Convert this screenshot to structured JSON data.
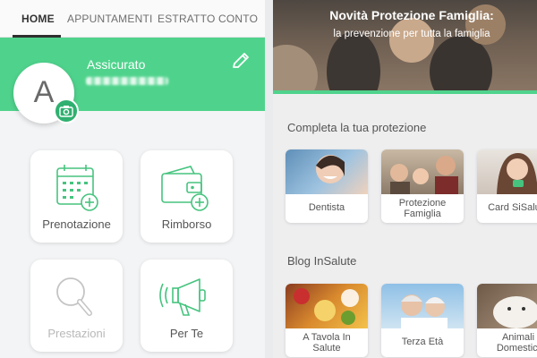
{
  "tabs": {
    "home": "HOME",
    "appuntamenti": "APPUNTAMENTI",
    "estratto": "ESTRATTO CONTO"
  },
  "profile": {
    "initial": "A",
    "label": "Assicurato"
  },
  "tiles": {
    "prenotazione": "Prenotazione",
    "rimborso": "Rimborso",
    "prestazioni": "Prestazioni",
    "perte": "Per Te"
  },
  "banner": {
    "title": "Novità Protezione Famiglia:",
    "subtitle": "la prevenzione per tutta la famiglia"
  },
  "protection": {
    "heading": "Completa la tua protezione",
    "cards": {
      "dentista": "Dentista",
      "famiglia_1": "Protezione",
      "famiglia_2": "Famiglia",
      "card": "Card SiSalute"
    }
  },
  "blog": {
    "heading": "Blog InSalute",
    "cards": {
      "tavola_1": "A Tavola In",
      "tavola_2": "Salute",
      "terza": "Terza Età",
      "animali_1": "Animali",
      "animali_2": "Domestici"
    }
  },
  "colors": {
    "accent_green": "#4fd38c",
    "icon_green": "#46c47f"
  }
}
